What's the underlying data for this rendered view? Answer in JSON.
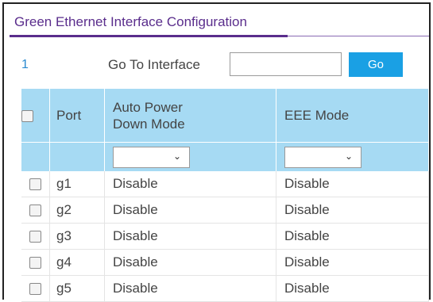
{
  "section": {
    "title": "Green Ethernet Interface Configuration"
  },
  "pager": {
    "page": "1"
  },
  "goto": {
    "label": "Go To Interface",
    "value": "",
    "button": "Go"
  },
  "table": {
    "headers": {
      "port": "Port",
      "auto_power_down_line1": "Auto Power",
      "auto_power_down_line2": "Down Mode",
      "eee": "EEE Mode"
    },
    "filters": {
      "auto_power_down": "",
      "eee": ""
    },
    "rows": [
      {
        "port": "g1",
        "auto_power_down": "Disable",
        "eee": "Disable"
      },
      {
        "port": "g2",
        "auto_power_down": "Disable",
        "eee": "Disable"
      },
      {
        "port": "g3",
        "auto_power_down": "Disable",
        "eee": "Disable"
      },
      {
        "port": "g4",
        "auto_power_down": "Disable",
        "eee": "Disable"
      },
      {
        "port": "g5",
        "auto_power_down": "Disable",
        "eee": "Disable"
      }
    ]
  },
  "icons": {
    "dropdown": "chevron-down-icon"
  },
  "colors": {
    "title": "#5a2d8c",
    "header_bg": "#a6daf3",
    "button_bg": "#1aa0e4",
    "link": "#2a8ad0"
  }
}
